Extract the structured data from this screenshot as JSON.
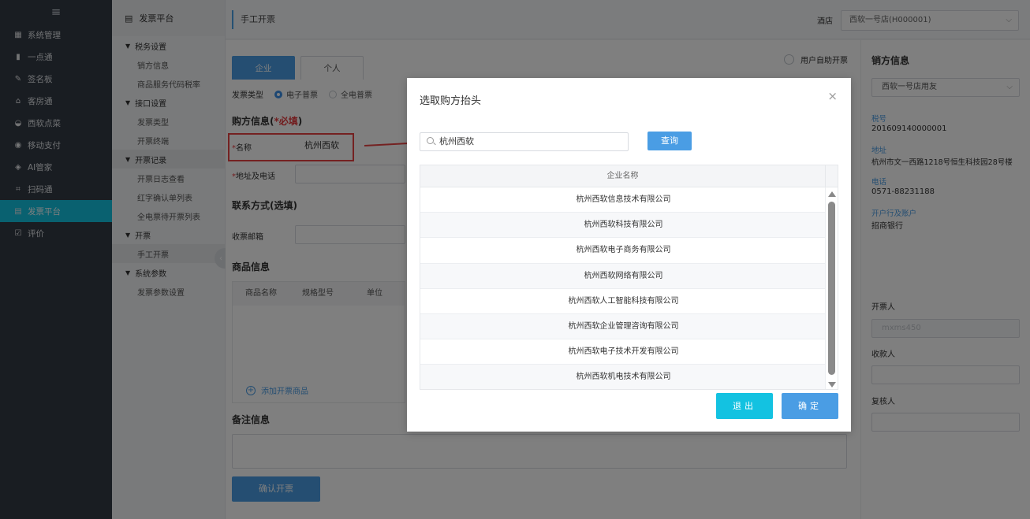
{
  "nav": {
    "items": [
      {
        "label": "系统管理",
        "icon": "grid-icon"
      },
      {
        "label": "一点通",
        "icon": "bar-chart-icon"
      },
      {
        "label": "签名板",
        "icon": "pen-icon"
      },
      {
        "label": "客房通",
        "icon": "home-icon"
      },
      {
        "label": "西软点菜",
        "icon": "dish-icon"
      },
      {
        "label": "移动支付",
        "icon": "pay-icon"
      },
      {
        "label": "AI管家",
        "icon": "robot-icon"
      },
      {
        "label": "扫码通",
        "icon": "scan-icon"
      },
      {
        "label": "发票平台",
        "icon": "invoice-icon"
      },
      {
        "label": "评价",
        "icon": "edit-icon"
      }
    ],
    "active_index": 8
  },
  "sub": {
    "title": "发票平台",
    "groups": [
      {
        "label": "税务设置",
        "leaves": [
          "销方信息",
          "商品服务代码税率"
        ]
      },
      {
        "label": "接口设置",
        "leaves": [
          "发票类型",
          "开票终端"
        ]
      },
      {
        "label": "开票记录",
        "leaves": [
          "开票日志查看",
          "红字确认单列表",
          "全电票待开票列表"
        ]
      },
      {
        "label": "开票",
        "leaves": [
          "手工开票"
        ]
      },
      {
        "label": "系统参数",
        "leaves": [
          "发票参数设置"
        ]
      }
    ]
  },
  "topbar": {
    "breadcrumb": "手工开票",
    "hotel_label": "酒店",
    "hotel_value": "西软一号店(H000001)"
  },
  "form": {
    "tabs": [
      "企业",
      "个人"
    ],
    "self_service": "用户自助开票",
    "invoice_type_label": "发票类型",
    "invoice_types": [
      "电子普票",
      "全电普票"
    ],
    "buyer_title": "购方信息(",
    "buyer_req": "*必填",
    "buyer_close": ")",
    "name_label": "名称",
    "name_value": "杭州西软",
    "addr_label": "地址及电话",
    "contact_title": "联系方式(选填)",
    "email_label": "收票邮箱",
    "goods_title": "商品信息",
    "goods_cols": [
      "商品名称",
      "规格型号",
      "单位"
    ],
    "add_goods": "添加开票商品",
    "remark_title": "备注信息",
    "confirm_btn": "确认开票"
  },
  "right": {
    "title": "销方信息",
    "seller_value": "西软一号店用友",
    "tax_no_k": "税号",
    "tax_no_v": "201609140000001",
    "addr_k": "地址",
    "addr_v": "杭州市文一西路1218号恒生科技园28号楼",
    "tel_k": "电话",
    "tel_v": "0571-88231188",
    "bank_k": "开户行及账户",
    "bank_v": "招商银行",
    "drawer_label": "开票人",
    "drawer_value": "mxms450",
    "payee_label": "收款人",
    "reviewer_label": "复核人"
  },
  "dialog": {
    "title": "选取购方抬头",
    "search_value": "杭州西软",
    "query_btn": "查询",
    "col_header": "企业名称",
    "rows": [
      "杭州西软信息技术有限公司",
      "杭州西软科技有限公司",
      "杭州西软电子商务有限公司",
      "杭州西软网络有限公司",
      "杭州西软人工智能科技有限公司",
      "杭州西软企业管理咨询有限公司",
      "杭州西软电子技术开发有限公司",
      "杭州西软机电技术有限公司"
    ],
    "exit_btn": "退出",
    "ok_btn": "确定"
  },
  "colors": {
    "nav_bg": "#333a45",
    "active": "#13c2e1",
    "primary": "#4a9de4",
    "annotation_red": "#e94343"
  }
}
